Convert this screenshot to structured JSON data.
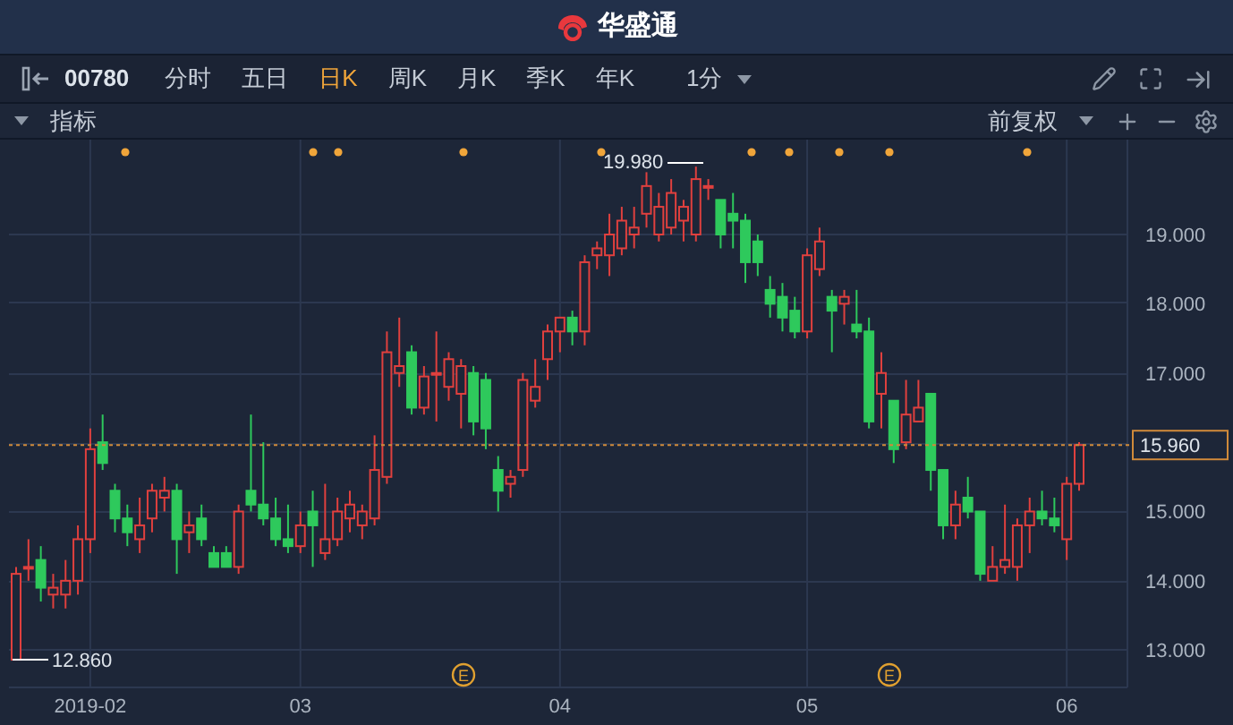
{
  "app_title": "华盛通",
  "toolbar": {
    "symbol": "00780",
    "periods": [
      {
        "label": "分时",
        "selected": false
      },
      {
        "label": "五日",
        "selected": false
      },
      {
        "label": "日K",
        "selected": true
      },
      {
        "label": "周K",
        "selected": false
      },
      {
        "label": "月K",
        "selected": false
      },
      {
        "label": "季K",
        "selected": false
      },
      {
        "label": "年K",
        "selected": false
      }
    ],
    "interval": "1分"
  },
  "indicator_bar": {
    "label": "指标",
    "adjustment": "前复权"
  },
  "chart": {
    "high_label": "19.980",
    "low_label": "12.860",
    "events": [
      "E",
      "E"
    ],
    "chart_data": {
      "type": "candlestick",
      "categories": [
        null,
        null,
        null,
        null,
        null,
        null,
        "2019-02",
        null,
        null,
        null,
        null,
        null,
        null,
        null,
        null,
        null,
        null,
        null,
        null,
        null,
        null,
        null,
        null,
        "03",
        null,
        null,
        null,
        null,
        null,
        null,
        null,
        null,
        null,
        null,
        null,
        null,
        null,
        null,
        null,
        null,
        null,
        null,
        null,
        null,
        "04",
        null,
        null,
        null,
        null,
        null,
        null,
        null,
        null,
        null,
        null,
        null,
        null,
        null,
        null,
        null,
        null,
        null,
        null,
        null,
        "05",
        null,
        null,
        null,
        null,
        null,
        null,
        null,
        null,
        null,
        null,
        null,
        null,
        null,
        null,
        null,
        null,
        null,
        null,
        null,
        null,
        "06",
        null
      ],
      "ylim": [
        12.46,
        20.37
      ],
      "grid": true,
      "ref_lines": [
        {
          "axis": "y",
          "value": 15.96,
          "label": "15.960",
          "color": "#d08a3a"
        }
      ],
      "ohlc": [
        [
          12.86,
          14.2,
          12.86,
          14.1
        ],
        [
          14.2,
          14.6,
          14.0,
          14.2
        ],
        [
          14.3,
          14.5,
          13.7,
          13.9
        ],
        [
          13.8,
          14.1,
          13.6,
          13.9
        ],
        [
          13.8,
          14.3,
          13.6,
          14.0
        ],
        [
          14.0,
          14.8,
          13.8,
          14.6
        ],
        [
          14.6,
          16.2,
          14.4,
          15.9
        ],
        [
          16.0,
          16.4,
          15.6,
          15.7
        ],
        [
          15.3,
          15.4,
          14.7,
          14.9
        ],
        [
          14.9,
          15.1,
          14.5,
          14.7
        ],
        [
          14.6,
          15.2,
          14.4,
          14.8
        ],
        [
          14.9,
          15.4,
          14.7,
          15.3
        ],
        [
          15.2,
          15.5,
          15.0,
          15.3
        ],
        [
          15.3,
          15.4,
          14.1,
          14.6
        ],
        [
          14.7,
          15.0,
          14.4,
          14.8
        ],
        [
          14.9,
          15.1,
          14.5,
          14.6
        ],
        [
          14.4,
          14.5,
          14.2,
          14.2
        ],
        [
          14.4,
          14.5,
          14.2,
          14.2
        ],
        [
          14.2,
          15.1,
          14.1,
          15.0
        ],
        [
          15.3,
          16.4,
          15.0,
          15.1
        ],
        [
          15.1,
          16.0,
          14.8,
          14.9
        ],
        [
          14.9,
          15.2,
          14.5,
          14.6
        ],
        [
          14.6,
          15.1,
          14.4,
          14.5
        ],
        [
          14.5,
          15.0,
          14.4,
          14.8
        ],
        [
          15.0,
          15.3,
          14.2,
          14.8
        ],
        [
          14.4,
          15.4,
          14.3,
          14.6
        ],
        [
          14.6,
          15.2,
          14.5,
          15.0
        ],
        [
          14.9,
          15.3,
          14.7,
          15.1
        ],
        [
          14.8,
          15.1,
          14.6,
          15.0
        ],
        [
          14.9,
          16.1,
          14.8,
          15.6
        ],
        [
          15.5,
          17.6,
          15.4,
          17.3
        ],
        [
          17.0,
          17.8,
          16.8,
          17.1
        ],
        [
          17.3,
          17.4,
          16.4,
          16.5
        ],
        [
          16.5,
          17.1,
          16.4,
          16.95
        ],
        [
          17.0,
          17.6,
          16.3,
          17.0
        ],
        [
          16.8,
          17.3,
          16.6,
          17.2
        ],
        [
          16.7,
          17.2,
          16.2,
          17.1
        ],
        [
          17.0,
          17.1,
          16.1,
          16.3
        ],
        [
          16.9,
          17.0,
          15.9,
          16.2
        ],
        [
          15.6,
          15.8,
          15.0,
          15.3
        ],
        [
          15.4,
          15.6,
          15.2,
          15.5
        ],
        [
          15.6,
          17.0,
          15.5,
          16.9
        ],
        [
          16.6,
          17.2,
          16.5,
          16.8
        ],
        [
          17.2,
          17.7,
          16.9,
          17.6
        ],
        [
          17.6,
          17.8,
          17.3,
          17.8
        ],
        [
          17.8,
          17.9,
          17.4,
          17.6
        ],
        [
          17.6,
          18.7,
          17.4,
          18.6
        ],
        [
          18.7,
          18.9,
          18.5,
          18.8
        ],
        [
          18.7,
          19.3,
          18.4,
          19.0
        ],
        [
          18.8,
          19.4,
          18.7,
          19.2
        ],
        [
          19.0,
          19.4,
          18.8,
          19.1
        ],
        [
          19.3,
          19.9,
          19.1,
          19.7
        ],
        [
          19.0,
          19.6,
          18.9,
          19.4
        ],
        [
          19.1,
          19.8,
          19.0,
          19.6
        ],
        [
          19.2,
          19.5,
          18.9,
          19.4
        ],
        [
          19.0,
          19.98,
          18.9,
          19.8
        ],
        [
          19.7,
          19.8,
          19.5,
          19.7
        ],
        [
          19.5,
          19.5,
          18.8,
          19.0
        ],
        [
          19.3,
          19.6,
          18.8,
          19.2
        ],
        [
          19.2,
          19.3,
          18.3,
          18.6
        ],
        [
          18.9,
          19.0,
          18.4,
          18.6
        ],
        [
          18.2,
          18.4,
          17.8,
          18.0
        ],
        [
          18.1,
          18.3,
          17.6,
          17.8
        ],
        [
          17.9,
          18.1,
          17.5,
          17.6
        ],
        [
          17.6,
          18.8,
          17.5,
          18.7
        ],
        [
          18.5,
          19.1,
          18.4,
          18.9
        ],
        [
          18.1,
          18.2,
          17.3,
          17.9
        ],
        [
          18.0,
          18.2,
          17.7,
          18.1
        ],
        [
          17.7,
          18.2,
          17.5,
          17.6
        ],
        [
          17.6,
          17.8,
          16.2,
          16.3
        ],
        [
          16.7,
          17.3,
          16.2,
          17.0
        ],
        [
          16.6,
          16.6,
          15.7,
          15.9
        ],
        [
          16.0,
          16.9,
          15.9,
          16.4
        ],
        [
          16.3,
          16.9,
          16.3,
          16.5
        ],
        [
          16.7,
          16.7,
          15.3,
          15.6
        ],
        [
          15.6,
          15.6,
          14.6,
          14.8
        ],
        [
          14.8,
          15.3,
          14.6,
          15.1
        ],
        [
          15.2,
          15.5,
          14.9,
          15.0
        ],
        [
          15.0,
          15.0,
          14.0,
          14.1
        ],
        [
          14.0,
          14.5,
          14.0,
          14.2
        ],
        [
          14.2,
          15.1,
          14.1,
          14.3
        ],
        [
          14.2,
          14.9,
          14.0,
          14.8
        ],
        [
          14.8,
          15.2,
          14.4,
          15.0
        ],
        [
          15.0,
          15.3,
          14.8,
          14.9
        ],
        [
          14.9,
          15.2,
          14.7,
          14.8
        ],
        [
          14.6,
          15.5,
          14.3,
          15.4
        ],
        [
          15.4,
          16.0,
          15.3,
          15.96
        ]
      ],
      "yticks": [
        {
          "value": 19,
          "label": "19.000"
        },
        {
          "value": 18,
          "label": "18.000"
        },
        {
          "value": 17,
          "label": "17.000"
        },
        {
          "value": 15,
          "label": "15.000"
        },
        {
          "value": 14,
          "label": "14.000"
        },
        {
          "value": 13,
          "label": "13.000"
        }
      ]
    }
  }
}
